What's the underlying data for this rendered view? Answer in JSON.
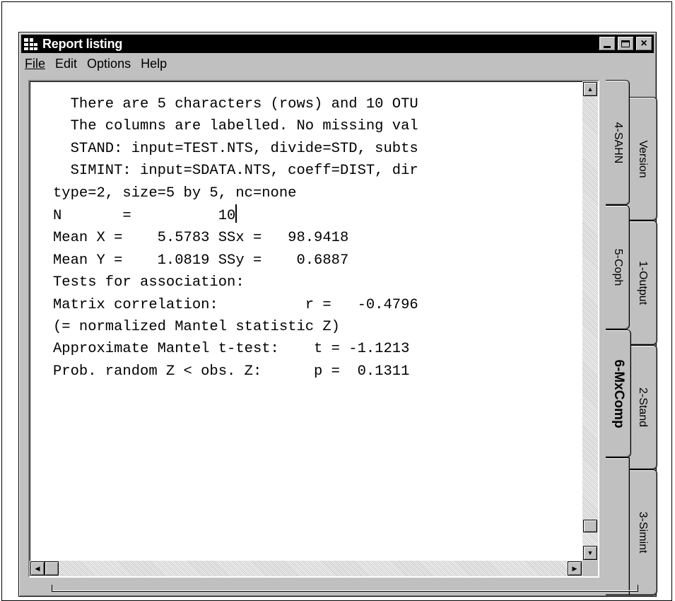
{
  "window": {
    "title": "Report listing",
    "buttons": {
      "minimize": "_",
      "maximize": "□",
      "close": "×"
    }
  },
  "menu": [
    {
      "label": "File",
      "mnemonic_underlined": true
    },
    {
      "label": "Edit"
    },
    {
      "label": "Options"
    },
    {
      "label": "Help"
    }
  ],
  "report": {
    "lines": [
      "  There are 5 characters (rows) and 10 OTU",
      "  The columns are labelled. No missing val",
      "  STAND: input=TEST.NTS, divide=STD, subts",
      "  SIMINT: input=SDATA.NTS, coeff=DIST, dir",
      "type=2, size=5 by 5, nc=none",
      "N       =          10",
      "Mean X =    5.5783 SSx =   98.9418",
      "Mean Y =    1.0819 SSy =    0.6887",
      "",
      "Tests for association:",
      "",
      "Matrix correlation:          r =   -0.4796",
      "(= normalized Mantel statistic Z)",
      "",
      "Approximate Mantel t-test:    t = -1.1213",
      "Prob. random Z < obs. Z:      p =  0.1311"
    ]
  },
  "tabs": {
    "inner": [
      {
        "label": "4-SAHN"
      },
      {
        "label": "5-Coph"
      },
      {
        "label": "6-MxComp",
        "active": true
      }
    ],
    "outer": [
      {
        "label": "Version"
      },
      {
        "label": "1-Output"
      },
      {
        "label": "2-Stand"
      },
      {
        "label": "3-Simint"
      }
    ]
  },
  "scroll_icons": {
    "up": "▲",
    "down": "▼",
    "left": "◀",
    "right": "▶"
  },
  "colors": {
    "titlebar": "#000000",
    "chrome": "#c0c0c0",
    "pane": "#ffffff"
  }
}
